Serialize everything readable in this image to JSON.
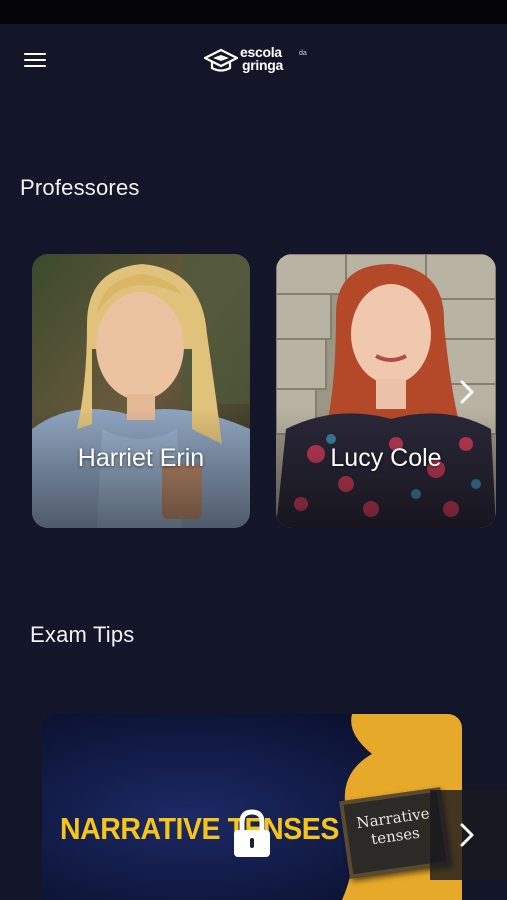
{
  "header": {
    "logo_line1": "escola",
    "logo_line2": "gringa",
    "logo_small": "da"
  },
  "sections": {
    "teachers_title": "Professores",
    "exam_title": "Exam Tips"
  },
  "teachers": [
    {
      "name": "Harriet Erin"
    },
    {
      "name": "Lucy Cole"
    }
  ],
  "exam_tips": [
    {
      "title": "NARRATIVE TENSES",
      "board_line1": "Narrative",
      "board_line2": "tenses",
      "locked": true
    }
  ],
  "colors": {
    "background": "#121628",
    "exam_title_yellow": "#f5c518"
  }
}
